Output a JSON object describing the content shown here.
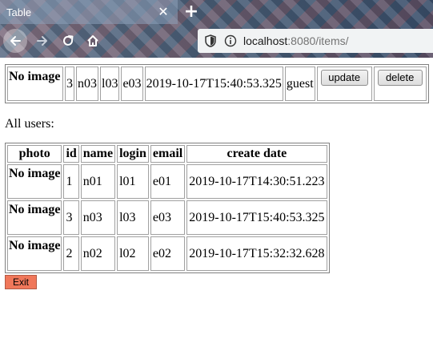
{
  "browser": {
    "tab_title": "Table",
    "tab_close_glyph": "✕",
    "new_tab_glyph": "+",
    "url_host": "localhost",
    "url_rest": ":8080/items/",
    "icons": [
      "back-icon",
      "forward-icon",
      "reload-icon",
      "home-icon",
      "shield-icon",
      "info-icon",
      "close-icon",
      "plus-icon"
    ]
  },
  "item": {
    "photo": "No image",
    "id": "3",
    "name": "n03",
    "login": "l03",
    "email": "e03",
    "create_date": "2019-10-17T15:40:53.325",
    "role": "guest",
    "update_label": "update",
    "delete_label": "delete"
  },
  "all_users_label": "All users:",
  "users": {
    "headers": [
      "photo",
      "id",
      "name",
      "login",
      "email",
      "create date"
    ],
    "rows": [
      {
        "photo": "No image",
        "id": "1",
        "name": "n01",
        "login": "l01",
        "email": "e01",
        "create_date": "2019-10-17T14:30:51.223"
      },
      {
        "photo": "No image",
        "id": "3",
        "name": "n03",
        "login": "l03",
        "email": "e03",
        "create_date": "2019-10-17T15:40:53.325"
      },
      {
        "photo": "No image",
        "id": "2",
        "name": "n02",
        "login": "l02",
        "email": "e02",
        "create_date": "2019-10-17T15:32:32.628"
      }
    ]
  },
  "exit_label": "Exit",
  "colors": {
    "exit_button": "#f0775a",
    "url_bar": "#f1f3f4"
  }
}
